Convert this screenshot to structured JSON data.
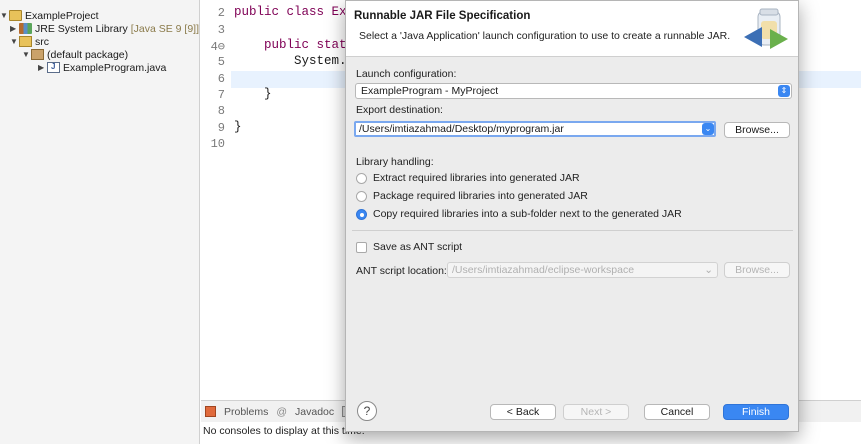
{
  "explorer": {
    "items": [
      {
        "label": "ExampleProject",
        "decor": ""
      },
      {
        "label": "JRE System Library",
        "decor": "[Java SE 9 [9]]"
      },
      {
        "label": "src",
        "decor": ""
      },
      {
        "label": "(default package)",
        "decor": ""
      },
      {
        "label": "ExampleProgram.java",
        "decor": ""
      }
    ]
  },
  "editor": {
    "lines": [
      {
        "num": "2",
        "code": "public class Exa"
      },
      {
        "num": "3",
        "code": ""
      },
      {
        "num": "4⊖",
        "code": "    public stati"
      },
      {
        "num": "5",
        "code": "        System.o"
      },
      {
        "num": "6",
        "code": ""
      },
      {
        "num": "7",
        "code": "    }"
      },
      {
        "num": "8",
        "code": ""
      },
      {
        "num": "9",
        "code": "}"
      },
      {
        "num": "10",
        "code": ""
      }
    ]
  },
  "bottom": {
    "tabs": [
      "Problems",
      "Javadoc",
      "D"
    ],
    "console_message": "No consoles to display at this time."
  },
  "dialog": {
    "title": "Runnable JAR File Specification",
    "description": "Select a 'Java Application' launch configuration to use to create a runnable JAR.",
    "launch_config_label": "Launch configuration:",
    "launch_config_value": "ExampleProgram - MyProject",
    "export_dest_label": "Export destination:",
    "export_dest_value": "/Users/imtiazahmad/Desktop/myprogram.jar",
    "browse_label": "Browse...",
    "library_label": "Library handling:",
    "library_options": [
      "Extract required libraries into generated JAR",
      "Package required libraries into generated JAR",
      "Copy required libraries into a sub-folder next to the generated JAR"
    ],
    "selected_option_index": 2,
    "save_ant_label": "Save as ANT script",
    "ant_location_label": "ANT script location:",
    "ant_location_value": "/Users/imtiazahmad/eclipse-workspace",
    "ant_browse_label": "Browse...",
    "help_label": "?",
    "back_label": "< Back",
    "next_label": "Next >",
    "cancel_label": "Cancel",
    "finish_label": "Finish"
  }
}
